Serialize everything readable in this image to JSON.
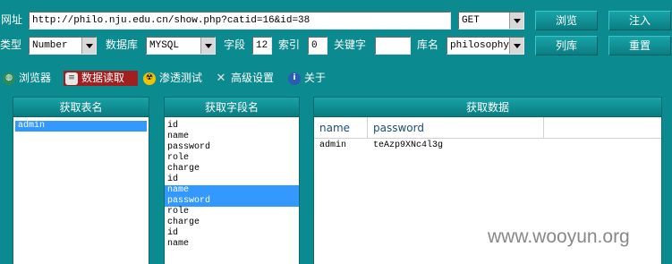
{
  "toolbar": {
    "url_label": "网址",
    "url_value": "http://philo.nju.edu.cn/show.php?catid=16&id=38",
    "method_value": "GET",
    "browse_btn": "浏览",
    "inject_btn": "注入",
    "type_label": "类型",
    "type_value": "Number",
    "db_label": "数据库",
    "db_value": "MYSQL",
    "fields_label": "字段",
    "fields_value": "12",
    "index_label": "索引",
    "index_value": "0",
    "keyword_label": "关键字",
    "keyword_value": "",
    "dbname_label": "库名",
    "dbname_value": "philosophy",
    "list_db_btn": "列库",
    "reset_btn": "重置"
  },
  "tabs": [
    {
      "label": "浏览器",
      "icon": "globe-icon"
    },
    {
      "label": "数据读取",
      "icon": "database-icon",
      "active": true
    },
    {
      "label": "渗透测试",
      "icon": "radiation-icon"
    },
    {
      "label": "高级设置",
      "icon": "tools-icon"
    },
    {
      "label": "关于",
      "icon": "info-icon"
    }
  ],
  "tables_panel": {
    "title": "获取表名",
    "items": [
      {
        "text": "admin",
        "selected": true
      }
    ]
  },
  "fields_panel": {
    "title": "获取字段名",
    "items": [
      {
        "text": "id"
      },
      {
        "text": "name"
      },
      {
        "text": "password"
      },
      {
        "text": "role"
      },
      {
        "text": "charge"
      },
      {
        "text": "id"
      },
      {
        "text": "name",
        "selected": true
      },
      {
        "text": "password",
        "selected": true
      },
      {
        "text": "role"
      },
      {
        "text": "charge"
      },
      {
        "text": "id"
      },
      {
        "text": "name"
      }
    ]
  },
  "data_panel": {
    "title": "获取数据",
    "columns": [
      "name",
      "password"
    ],
    "rows": [
      [
        "admin",
        "teAzp9XNc4l3g"
      ]
    ]
  },
  "watermark": "www.wooyun.org",
  "colors": {
    "background": "#0b8a8f",
    "selected": "#3399ff",
    "active_tab": "#a11f1f"
  }
}
